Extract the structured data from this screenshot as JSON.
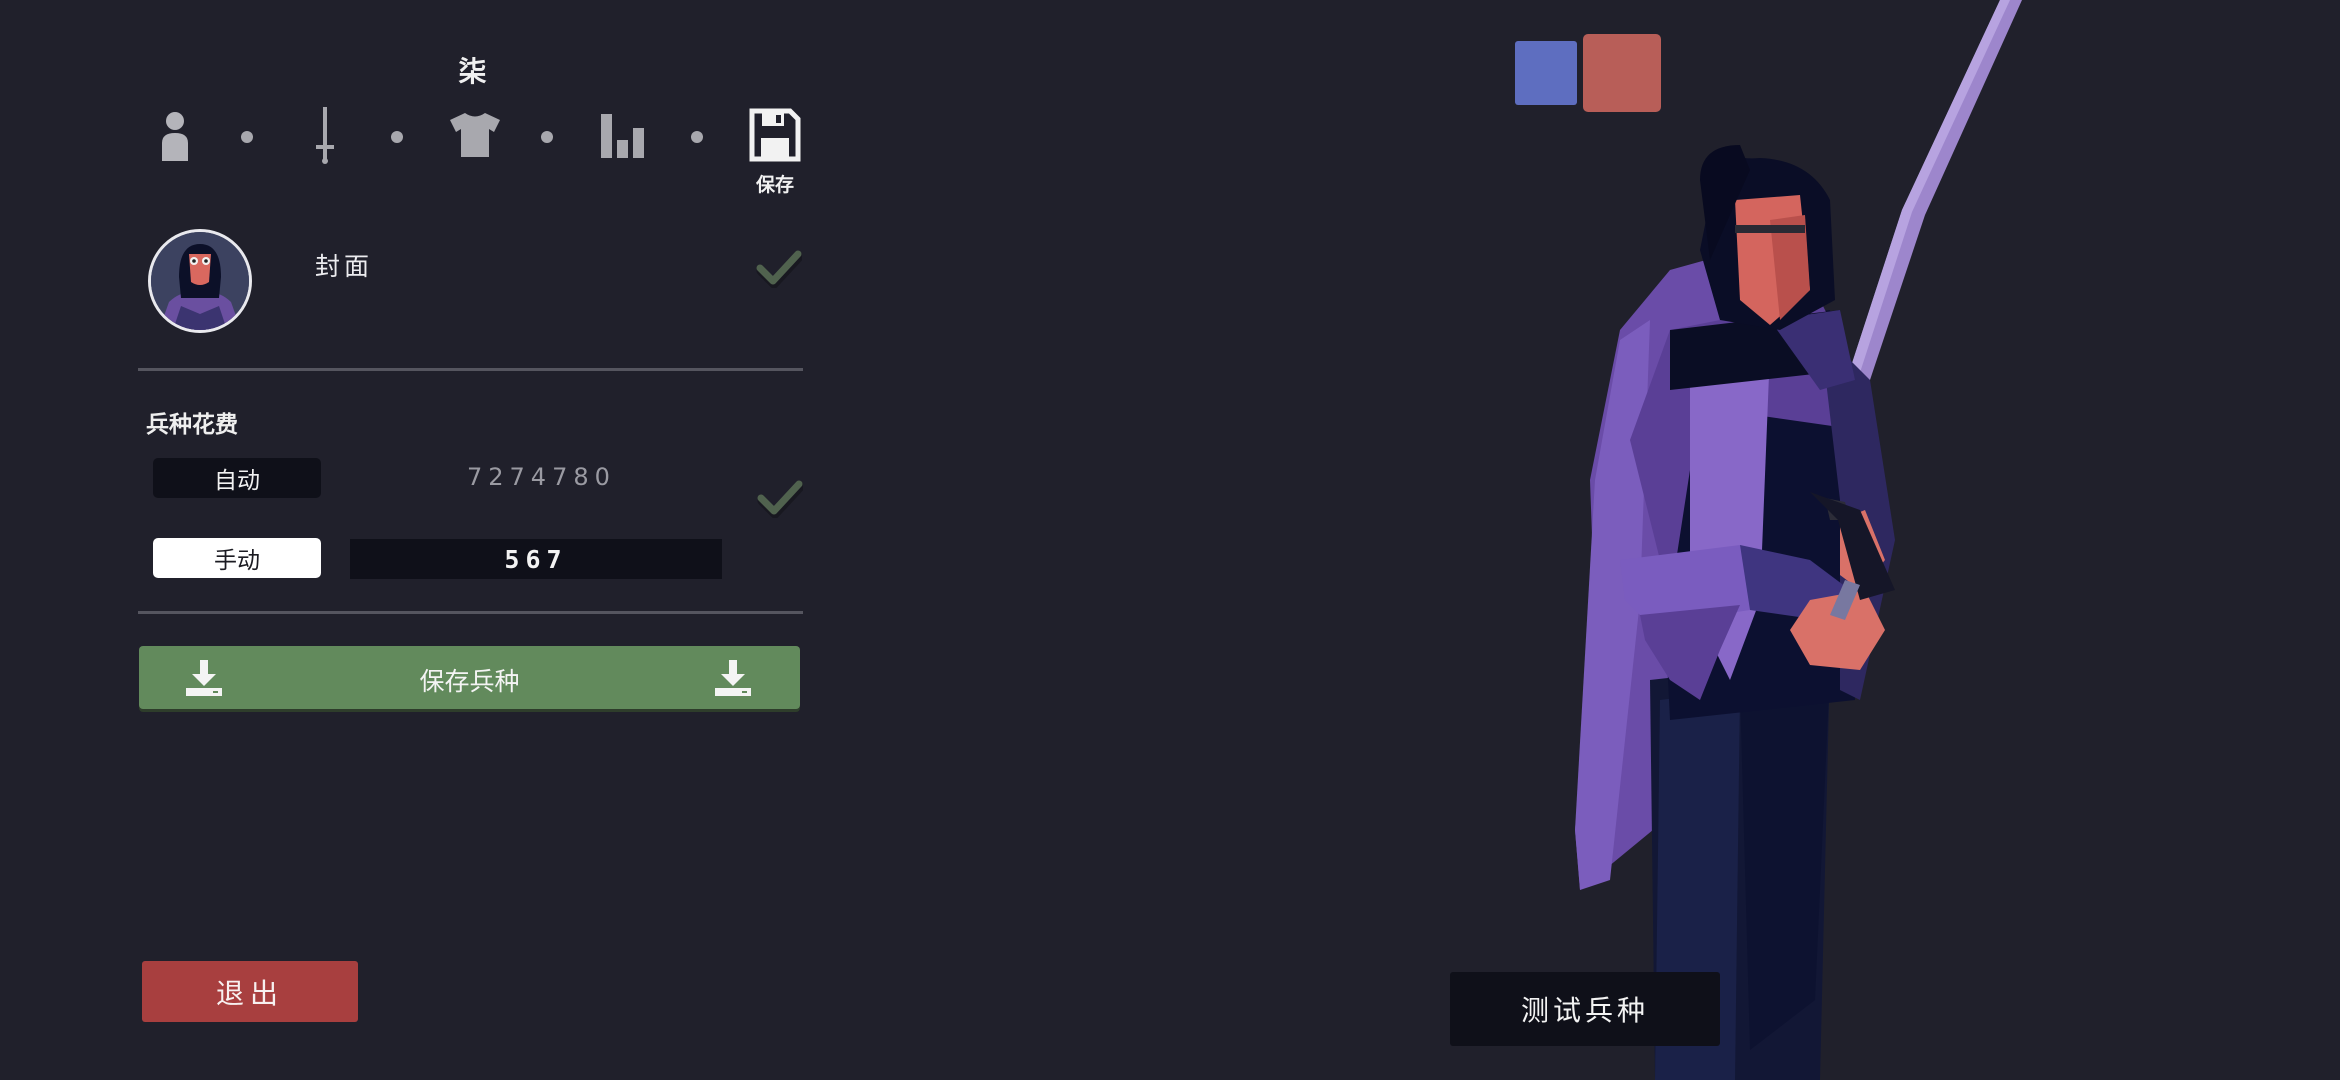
{
  "unit": {
    "name": "柒"
  },
  "tabs": [
    {
      "id": "body",
      "icon": "person-icon"
    },
    {
      "id": "weapon",
      "icon": "sword-icon"
    },
    {
      "id": "clothing",
      "icon": "shirt-icon"
    },
    {
      "id": "stats",
      "icon": "bar-chart-icon"
    },
    {
      "id": "save",
      "icon": "floppy-disk-icon",
      "label": "保存",
      "active": true
    }
  ],
  "cover": {
    "label": "封面",
    "checked": true
  },
  "cost": {
    "title": "兵种花费",
    "auto_label": "自动",
    "auto_value": "7274780",
    "manual_label": "手动",
    "manual_value": "567",
    "checked": true
  },
  "save_unit": {
    "label": "保存兵种",
    "icon": "download-icon"
  },
  "exit": {
    "label": "退出"
  },
  "team_colors": {
    "blue": "#5e6ec0",
    "red": "#b85e58"
  },
  "test_unit": {
    "label": "测试兵种"
  },
  "colors": {
    "save_green": "#628a5c",
    "exit_red": "#a83f3f",
    "background": "#20202b"
  }
}
